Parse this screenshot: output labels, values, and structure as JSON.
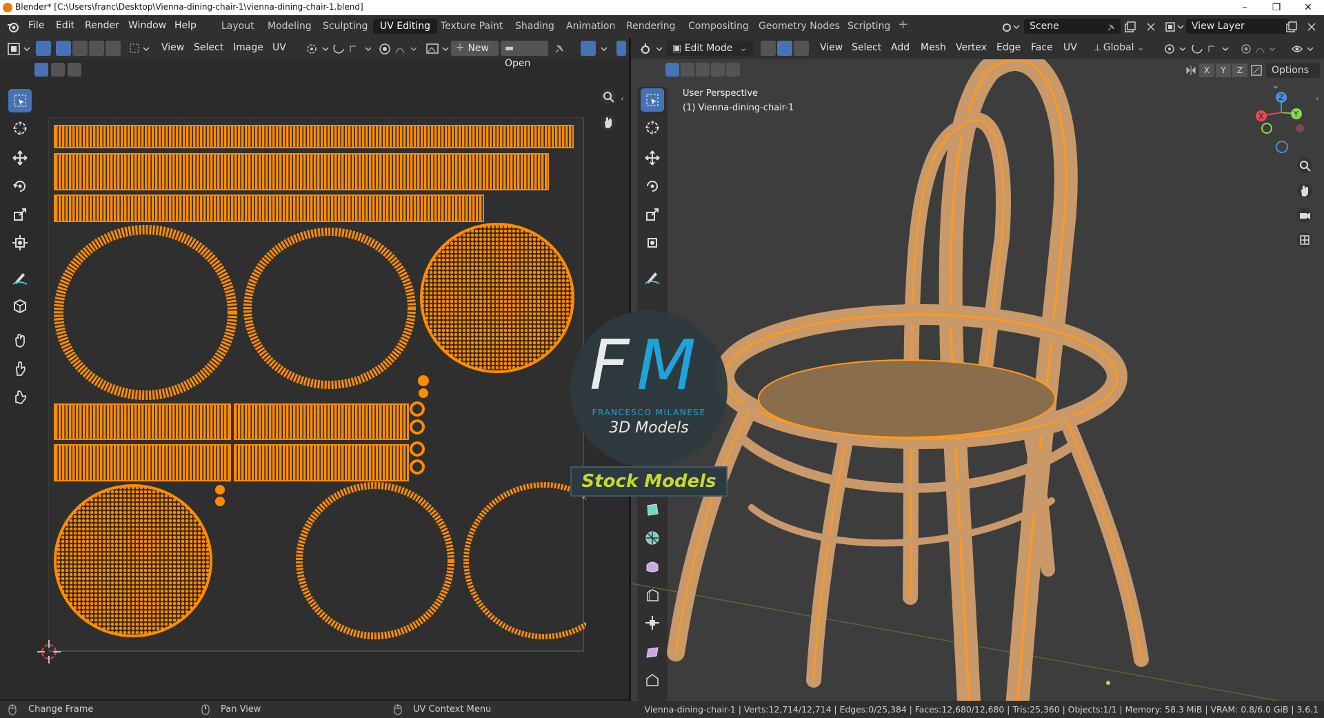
{
  "window": {
    "title": "Blender* [C:\\Users\\franc\\Desktop\\Vienna-dining-chair-1\\vienna-dining-chair-1.blend]",
    "controls": [
      "–",
      "❐",
      "✕"
    ]
  },
  "menu": [
    "File",
    "Edit",
    "Render",
    "Window",
    "Help"
  ],
  "workspaces": [
    "Layout",
    "Modeling",
    "Sculpting",
    "UV Editing",
    "Texture Paint",
    "Shading",
    "Animation",
    "Rendering",
    "Compositing",
    "Geometry Nodes",
    "Scripting"
  ],
  "active_workspace": "UV Editing",
  "scene": {
    "name": "Scene",
    "view_layer": "View Layer"
  },
  "uv_editor": {
    "menus": [
      "View",
      "Select",
      "Image",
      "UV"
    ],
    "new_label": "New",
    "open_label": "Open"
  },
  "viewport": {
    "mode": "Edit Mode",
    "menus": [
      "View",
      "Select",
      "Add",
      "Mesh",
      "Vertex",
      "Edge",
      "Face",
      "UV"
    ],
    "orientation": "Global",
    "axes": [
      "X",
      "Y",
      "Z"
    ],
    "options_label": "Options",
    "overlay_view": "User Perspective",
    "overlay_object": "(1) Vienna-dining-chair-1",
    "gizmo": {
      "x": "X",
      "y": "Y",
      "z": "Z"
    }
  },
  "watermark": {
    "initials_f": "F",
    "initials_m": "M",
    "name": "FRANCESCO MILANESE",
    "line2": "3D Models",
    "banner": "Stock Models"
  },
  "statusbar": {
    "left": [
      "Change Frame",
      "Pan View",
      "UV Context Menu"
    ],
    "stats": "Vienna-dining-chair-1 | Verts:12,714/12,714 | Edges:0/25,384 | Faces:12,680/12,680 | Tris:25,360 | Objects:1/1 | Memory: 58.3 MiB | VRAM: 0.8/6.0 GiB | 3.6.1"
  },
  "colors": {
    "accent": "#4772b3",
    "uv": "#ff8c00",
    "header": "#303030",
    "panel": "#2b2b2b"
  }
}
